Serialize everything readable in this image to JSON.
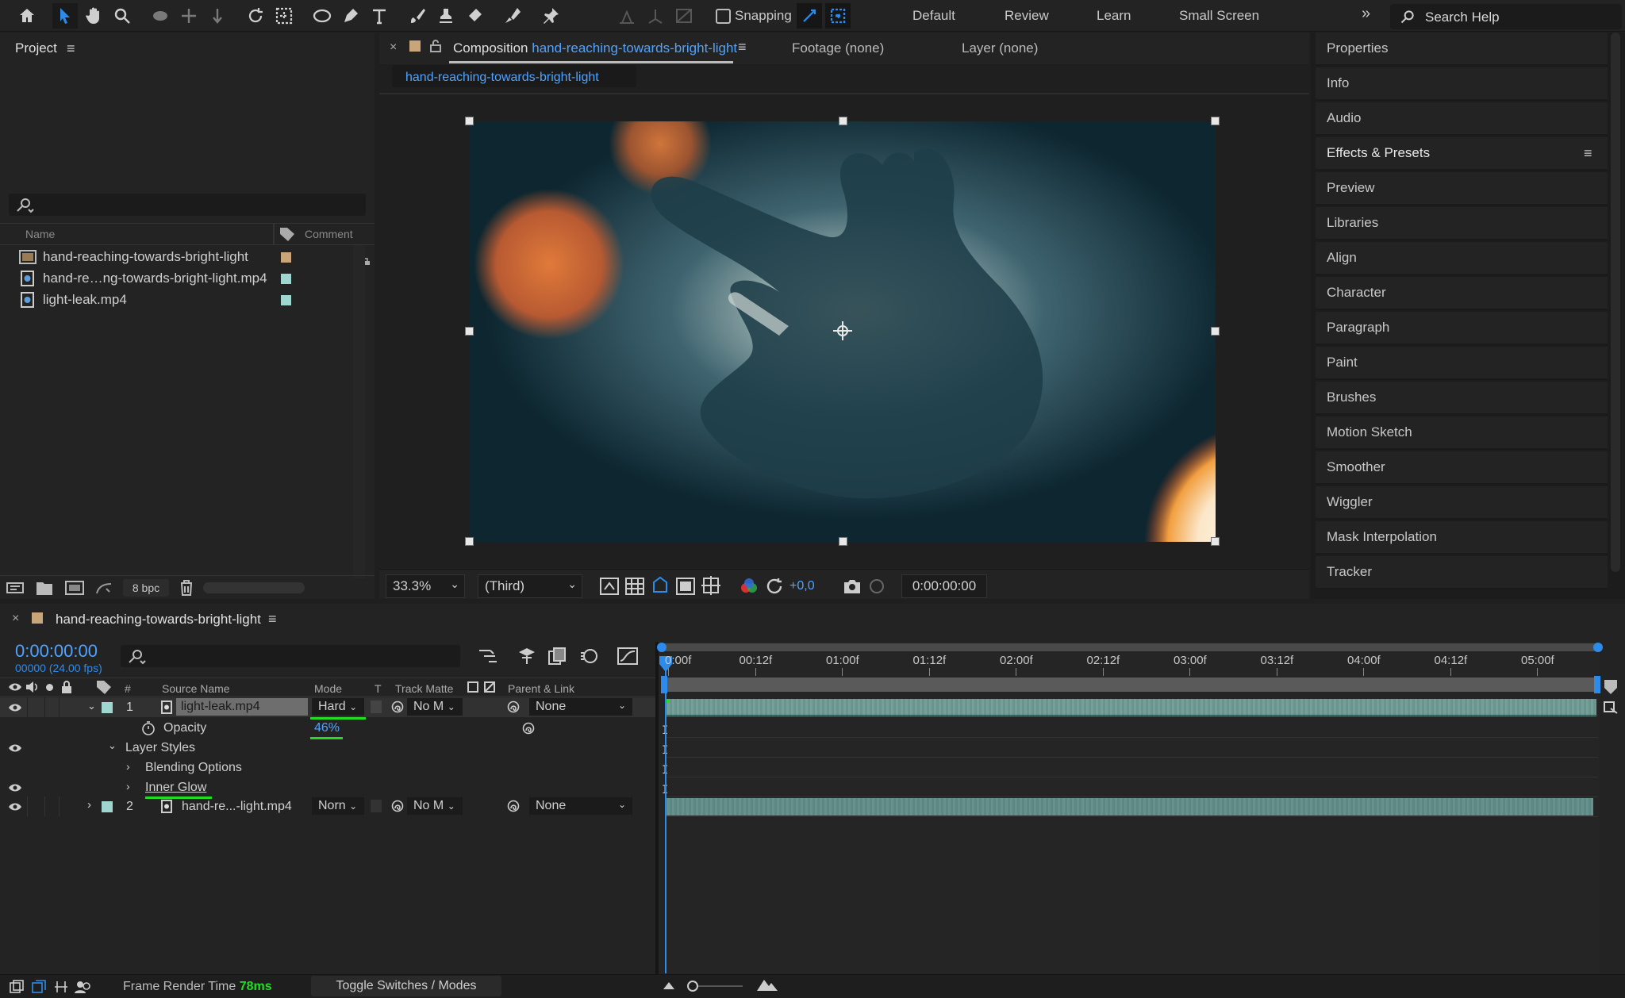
{
  "toolbar": {
    "snapping_label": "Snapping",
    "snapping_checked": false,
    "workspaces": [
      "Default",
      "Review",
      "Learn",
      "Small Screen"
    ],
    "search_placeholder": "Search Help",
    "icons": [
      "home-icon",
      "selection-tool-icon",
      "hand-tool-icon",
      "zoom-tool-icon",
      "orbit-camera-icon",
      "pan-camera-icon",
      "dolly-camera-icon",
      "rotation-tool-icon",
      "pan-behind-tool-icon",
      "ellipse-tool-icon",
      "pen-tool-icon",
      "type-tool-icon",
      "brush-tool-icon",
      "clone-stamp-icon",
      "eraser-icon",
      "roto-brush-icon",
      "puppet-pin-icon"
    ]
  },
  "project": {
    "title": "Project",
    "search_placeholder": "",
    "columns": {
      "name": "Name",
      "comment": "Comment"
    },
    "items": [
      {
        "name": "hand-reaching-towards-bright-light",
        "type": "composition",
        "label_color": "#c9a57a"
      },
      {
        "name": "hand-re…ng-towards-bright-light.mp4",
        "type": "footage",
        "label_color": "#9fd6cf"
      },
      {
        "name": "light-leak.mp4",
        "type": "footage",
        "label_color": "#9fd6cf"
      }
    ],
    "bit_depth": "8 bpc"
  },
  "viewer": {
    "tab_prefix": "Composition",
    "comp_name": "hand-reaching-towards-bright-light",
    "footage_tab": "Footage (none)",
    "layer_tab": "Layer (none)",
    "flowchart_tab": "hand-reaching-towards-bright-light",
    "zoom": "33.3%",
    "resolution": "(Third)",
    "exposure": "+0,0",
    "timecode": "0:00:00:00"
  },
  "right_panel": {
    "items": [
      "Properties",
      "Info",
      "Audio",
      "Effects & Presets",
      "Preview",
      "Libraries",
      "Align",
      "Character",
      "Paragraph",
      "Paint",
      "Brushes",
      "Motion Sketch",
      "Smoother",
      "Wiggler",
      "Mask Interpolation",
      "Tracker"
    ],
    "active": "Effects & Presets"
  },
  "timeline": {
    "comp_name": "hand-reaching-towards-bright-light",
    "timecode": "0:00:00:00",
    "frame_info": "00000 (24.00 fps)",
    "columns": {
      "num": "#",
      "source": "Source Name",
      "mode": "Mode",
      "t": "T",
      "track_matte": "Track Matte",
      "parent": "Parent & Link"
    },
    "ruler": [
      "0:00f",
      "00:12f",
      "01:00f",
      "01:12f",
      "02:00f",
      "02:12f",
      "03:00f",
      "03:12f",
      "04:00f",
      "04:12f",
      "05:00f"
    ],
    "layers": [
      {
        "num": "1",
        "name": "light-leak.mp4",
        "mode": "Hard",
        "track_matte": "No M",
        "parent": "None",
        "color": "#9fd6cf",
        "expanded": true
      },
      {
        "num": "2",
        "name": "hand-re...-light.mp4",
        "mode": "Norn",
        "track_matte": "No M",
        "parent": "None",
        "color": "#9fd6cf",
        "expanded": false
      }
    ],
    "opacity_label": "Opacity",
    "opacity_value": "46%",
    "layer_styles": "Layer Styles",
    "blending_options": "Blending Options",
    "inner_glow": "Inner Glow"
  },
  "status": {
    "render_label": "Frame Render Time",
    "render_value": "78ms",
    "toggle_label": "Toggle Switches / Modes"
  },
  "colors": {
    "accent": "#2d8ceb",
    "highlight": "#22dd22",
    "timecode": "#4fa3ff",
    "layer_bar": "#5f8b86"
  }
}
